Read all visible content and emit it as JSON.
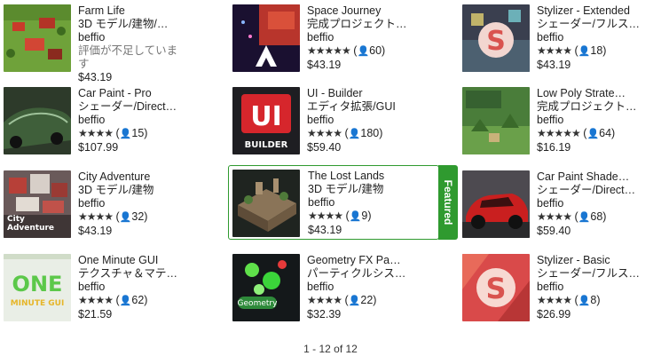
{
  "products": [
    {
      "title": "Farm Life",
      "category": "3D モデル/建物/…",
      "publisher": "beffio",
      "status": "評価が不足しています",
      "stars": "",
      "count": "",
      "price": "$43.19"
    },
    {
      "title": "Space Journey",
      "category": "完成プロジェクト…",
      "publisher": "beffio",
      "stars": "★★★★★",
      "count": "60",
      "price": "$43.19"
    },
    {
      "title": "Stylizer - Extended",
      "category": "シェーダー/フルス…",
      "publisher": "beffio",
      "stars": "★★★★",
      "count": "18",
      "price": "$43.19"
    },
    {
      "title": "Car Paint - Pro",
      "category": "シェーダー/Direct…",
      "publisher": "beffio",
      "stars": "★★★★",
      "count": "15",
      "price": "$107.99"
    },
    {
      "title": "UI - Builder",
      "category": "エディタ拡張/GUI",
      "publisher": "beffio",
      "stars": "★★★★",
      "count": "180",
      "price": "$59.40",
      "thumb_text": "UI",
      "thumb_sub": "BUILDER"
    },
    {
      "title": "Low Poly Strate…",
      "category": "完成プロジェクト…",
      "publisher": "beffio",
      "stars": "★★★★★",
      "count": "64",
      "price": "$16.19"
    },
    {
      "title": "City Adventure",
      "category": "3D モデル/建物",
      "publisher": "beffio",
      "stars": "★★★★",
      "count": "32",
      "price": "$43.19",
      "thumb_text": "City Adventure"
    },
    {
      "title": "The Lost Lands",
      "category": "3D モデル/建物",
      "publisher": "beffio",
      "stars": "★★★★",
      "count": "9",
      "price": "$43.19",
      "featured": true
    },
    {
      "title": "Car Paint Shade…",
      "category": "シェーダー/Direct…",
      "publisher": "beffio",
      "stars": "★★★★",
      "count": "68",
      "price": "$59.40"
    },
    {
      "title": "One Minute GUI",
      "category": "テクスチャ＆マテ…",
      "publisher": "beffio",
      "stars": "★★★★",
      "count": "62",
      "price": "$21.59",
      "thumb_text": "ONE",
      "thumb_sub": "MINUTE GUI"
    },
    {
      "title": "Geometry FX Pa…",
      "category": "パーティクルシス…",
      "publisher": "beffio",
      "stars": "★★★★",
      "count": "22",
      "price": "$32.39",
      "thumb_text": "Geometry"
    },
    {
      "title": "Stylizer - Basic",
      "category": "シェーダー/フルス…",
      "publisher": "beffio",
      "stars": "★★★★",
      "count": "8",
      "price": "$26.99"
    }
  ],
  "featured_label": "Featured",
  "pagination": "1 - 12 of 12",
  "icons": {
    "rating_count": "person-icon"
  },
  "colors": {
    "featured": "#2f9a2f"
  }
}
